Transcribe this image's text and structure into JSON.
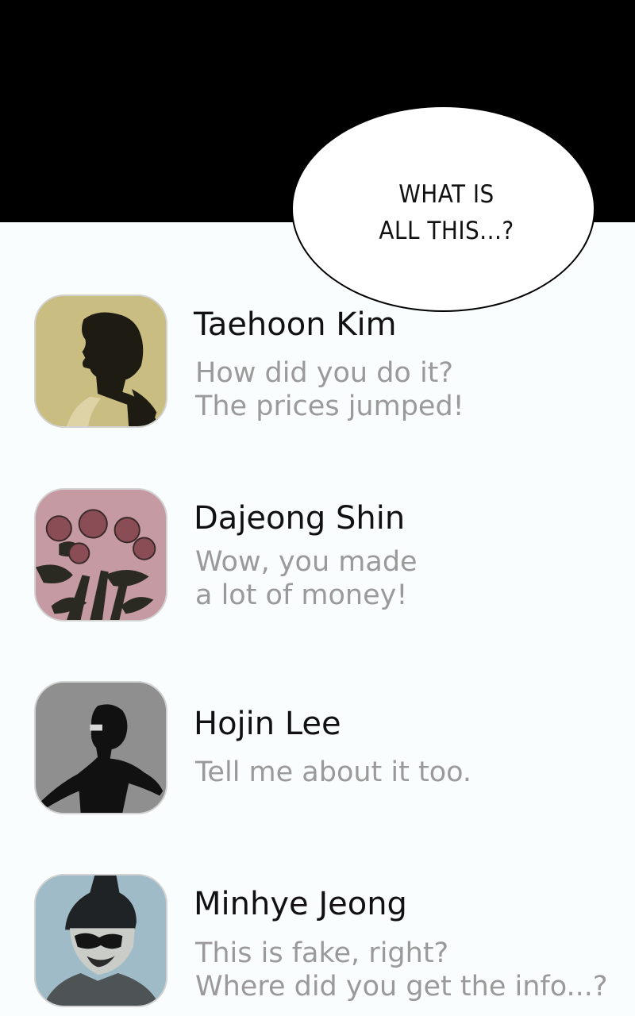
{
  "speech_bubble": {
    "text": "WHAT IS\nALL THIS...?"
  },
  "contacts": [
    {
      "name": "Taehoon Kim",
      "message": "How did you do it?\nThe prices jumped!",
      "avatar_color": "#c9bd82",
      "avatar_icon": "man-profile-avatar-icon"
    },
    {
      "name": "Dajeong Shin",
      "message": "Wow, you made\na lot of money!",
      "avatar_color": "#c69aa3",
      "avatar_icon": "flowers-avatar-icon"
    },
    {
      "name": "Hojin Lee",
      "message": "Tell me about it too.",
      "avatar_color": "#8f8f8f",
      "avatar_icon": "man-silhouette-avatar-icon"
    },
    {
      "name": "Minhye Jeong",
      "message": "This is fake, right?\nWhere did you get the info...?",
      "avatar_color": "#9fbbc7",
      "avatar_icon": "woman-sunglasses-avatar-icon"
    }
  ]
}
